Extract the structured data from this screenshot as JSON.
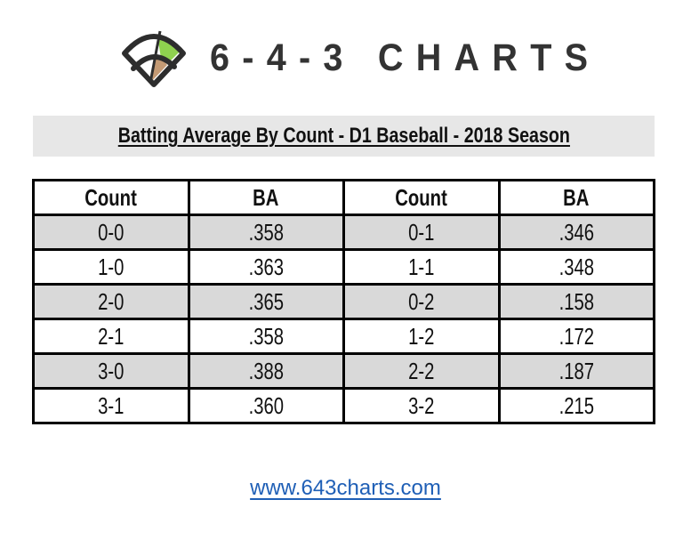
{
  "logo": {
    "icon": "baseball-field-icon",
    "text": "6-4-3 CHARTS",
    "colors": {
      "outline": "#2d2d2d",
      "outfield_grass": "#8fd14f",
      "infield_dirt": "#c49a74"
    }
  },
  "banner": {
    "title": "Batting Average By Count - D1 Baseball - 2018 Season"
  },
  "table": {
    "headers": [
      "Count",
      "BA",
      "Count",
      "BA"
    ],
    "rows": [
      {
        "count_left": "0-0",
        "ba_left": ".358",
        "count_right": "0-1",
        "ba_right": ".346",
        "shaded": true
      },
      {
        "count_left": "1-0",
        "ba_left": ".363",
        "count_right": "1-1",
        "ba_right": ".348",
        "shaded": false
      },
      {
        "count_left": "2-0",
        "ba_left": ".365",
        "count_right": "0-2",
        "ba_right": ".158",
        "shaded": true
      },
      {
        "count_left": "2-1",
        "ba_left": ".358",
        "count_right": "1-2",
        "ba_right": ".172",
        "shaded": false
      },
      {
        "count_left": "3-0",
        "ba_left": ".388",
        "count_right": "2-2",
        "ba_right": ".187",
        "shaded": true
      },
      {
        "count_left": "3-1",
        "ba_left": ".360",
        "count_right": "3-2",
        "ba_right": ".215",
        "shaded": false
      }
    ]
  },
  "footer": {
    "link_text": "www.643charts.com"
  },
  "colors": {
    "banner_bg": "#e7e7e7",
    "shaded_row": "#d9d9d9",
    "link": "#1f5fb6",
    "text": "#111111"
  }
}
